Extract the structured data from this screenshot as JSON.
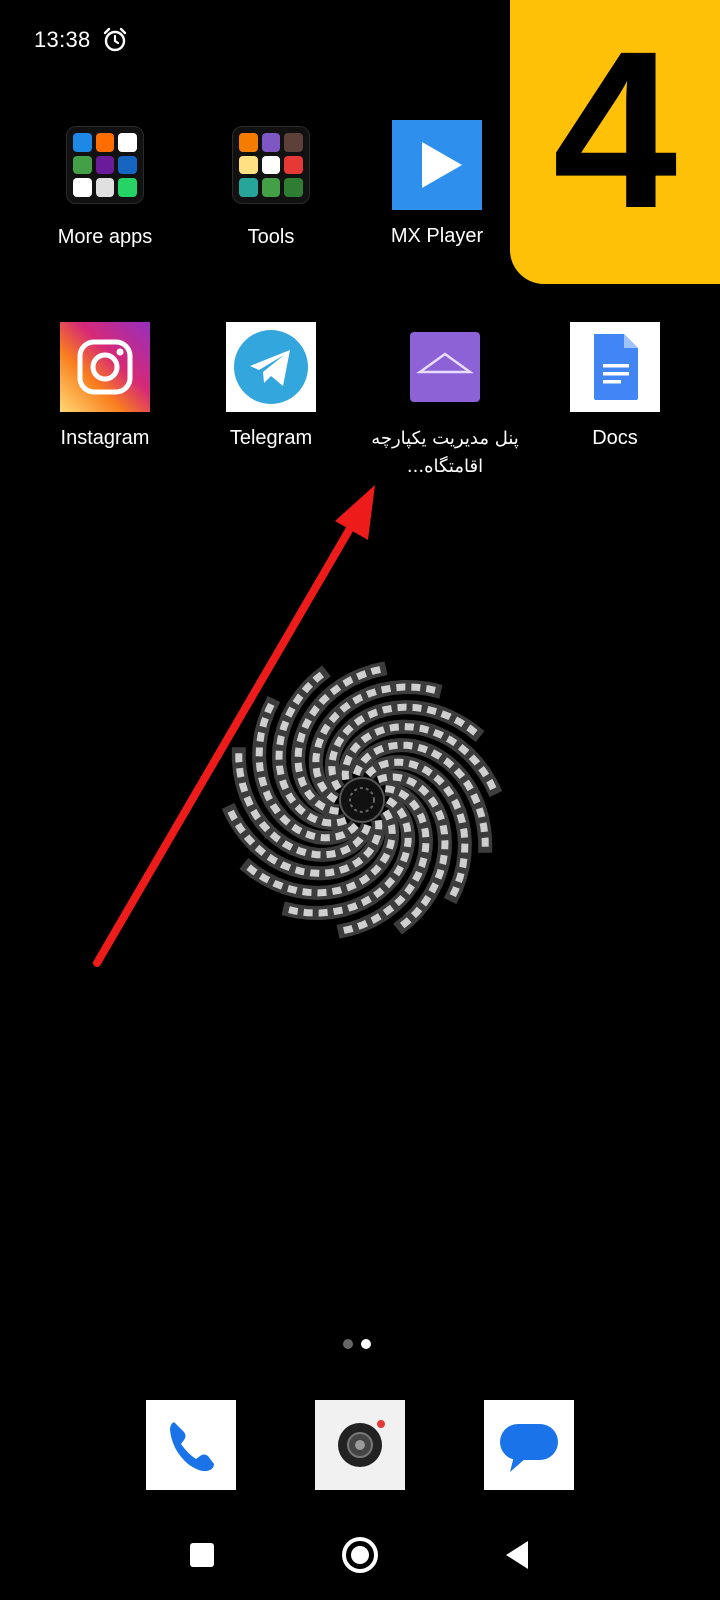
{
  "status_bar": {
    "time": "13:38",
    "alarm_icon": "alarm-clock-icon"
  },
  "badge": {
    "number": "4",
    "color": "#FFC107"
  },
  "home": {
    "row1": [
      {
        "label": "More apps",
        "icon": "more-apps-folder-icon"
      },
      {
        "label": "Tools",
        "icon": "tools-folder-icon"
      },
      {
        "label": "MX Player",
        "icon": "mx-player-icon"
      }
    ],
    "row2": [
      {
        "label": "Instagram",
        "icon": "instagram-icon"
      },
      {
        "label": "Telegram",
        "icon": "telegram-icon"
      },
      {
        "label": "پنل مدیریت یکپارچه اقامتگاه...",
        "icon": "residence-panel-icon"
      },
      {
        "label": "Docs",
        "icon": "google-docs-icon"
      }
    ]
  },
  "page_indicator": {
    "count": 2,
    "active": 2
  },
  "dock": [
    {
      "icon": "phone-icon"
    },
    {
      "icon": "camera-icon"
    },
    {
      "icon": "messages-icon"
    }
  ],
  "navigation": [
    {
      "icon": "recents-square-icon"
    },
    {
      "icon": "home-circle-icon"
    },
    {
      "icon": "back-triangle-icon"
    }
  ],
  "colors": {
    "annotation_arrow": "#EE1B1B",
    "accent_badge": "#FFC107"
  }
}
